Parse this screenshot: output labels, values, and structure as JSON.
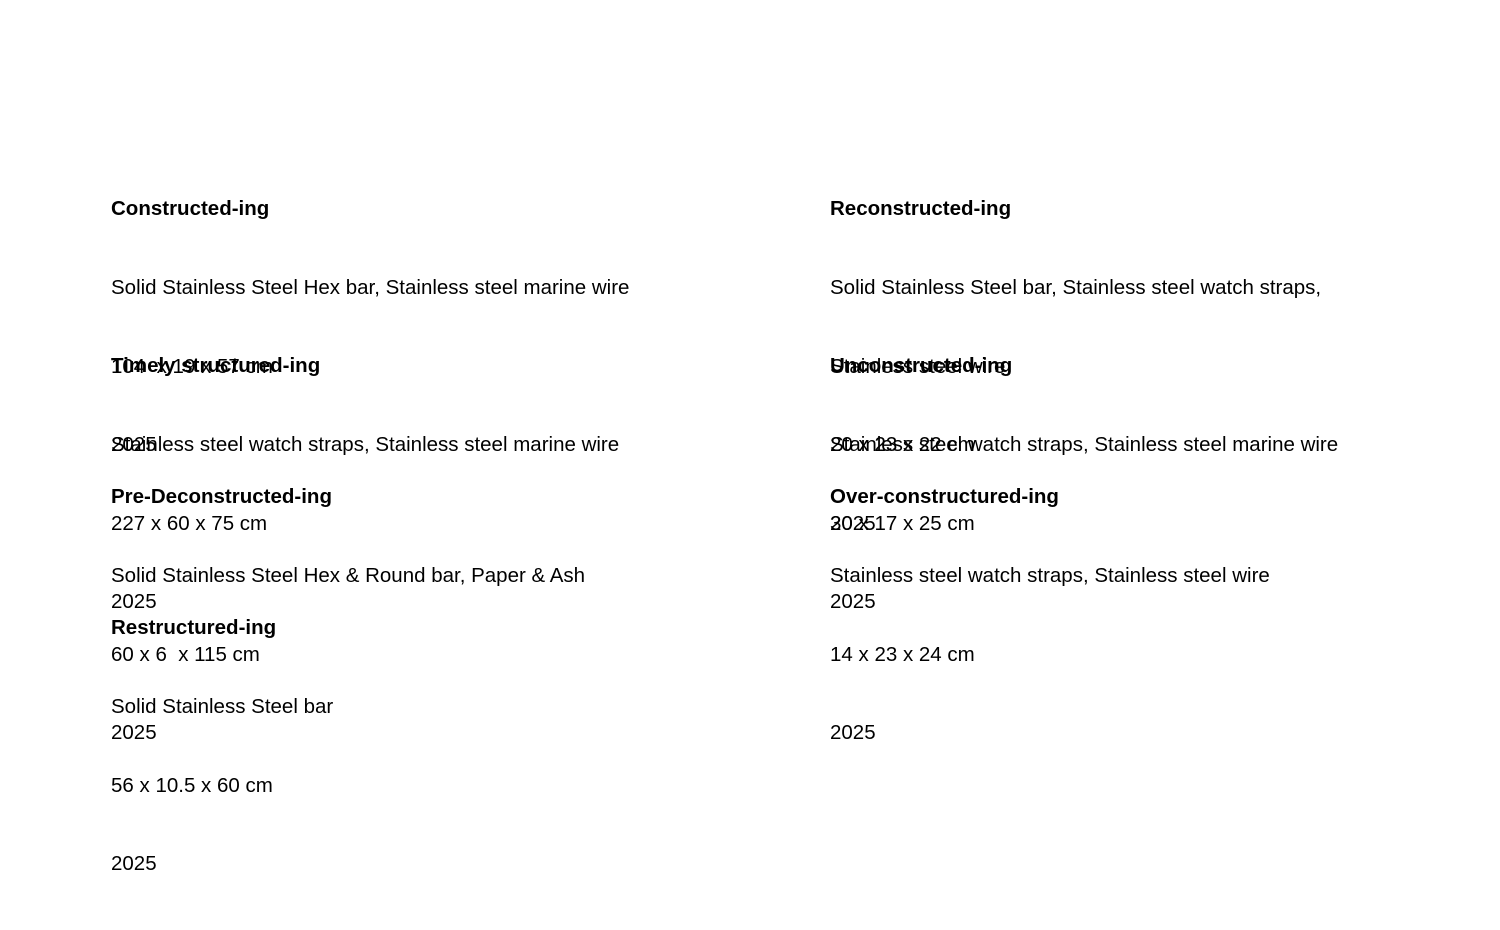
{
  "left_column": [
    {
      "title": "Constructed-ing",
      "materials": "Solid Stainless Steel Hex bar, Stainless steel marine wire",
      "materials_line2": "",
      "dimensions": "104  x 19 x 57 cm",
      "year": "2025"
    },
    {
      "title": "Timely structured-ing",
      "materials": "Stainless steel watch straps, Stainless steel marine wire",
      "materials_line2": "",
      "dimensions": "227 x 60 x 75 cm",
      "year": "2025"
    },
    {
      "title": "Pre-Deconstructed-ing",
      "materials": "Solid Stainless Steel Hex & Round bar, Paper & Ash",
      "materials_line2": "",
      "dimensions": "60 x 6  x 115 cm",
      "year": "2025"
    },
    {
      "title": "Restructured-ing",
      "materials": "Solid Stainless Steel bar",
      "materials_line2": "",
      "dimensions": "56 x 10.5 x 60 cm",
      "year": "2025"
    }
  ],
  "right_column": [
    {
      "title": "Reconstructed-ing",
      "materials": "Solid Stainless Steel bar, Stainless steel watch straps,",
      "materials_line2": "Stainless steel wire",
      "dimensions": "20 x 23 x 22 cm",
      "year": "2025"
    },
    {
      "title": "Unconstructed-ing",
      "materials": "Stainless steel watch straps, Stainless steel marine wire",
      "materials_line2": "",
      "dimensions": "30 x 17 x 25 cm",
      "year": "2025"
    },
    {
      "title": "Over-constructured-ing",
      "materials": "Stainless steel watch straps, Stainless steel wire",
      "materials_line2": "",
      "dimensions": "14 x 23 x 24 cm",
      "year": "2025"
    }
  ]
}
